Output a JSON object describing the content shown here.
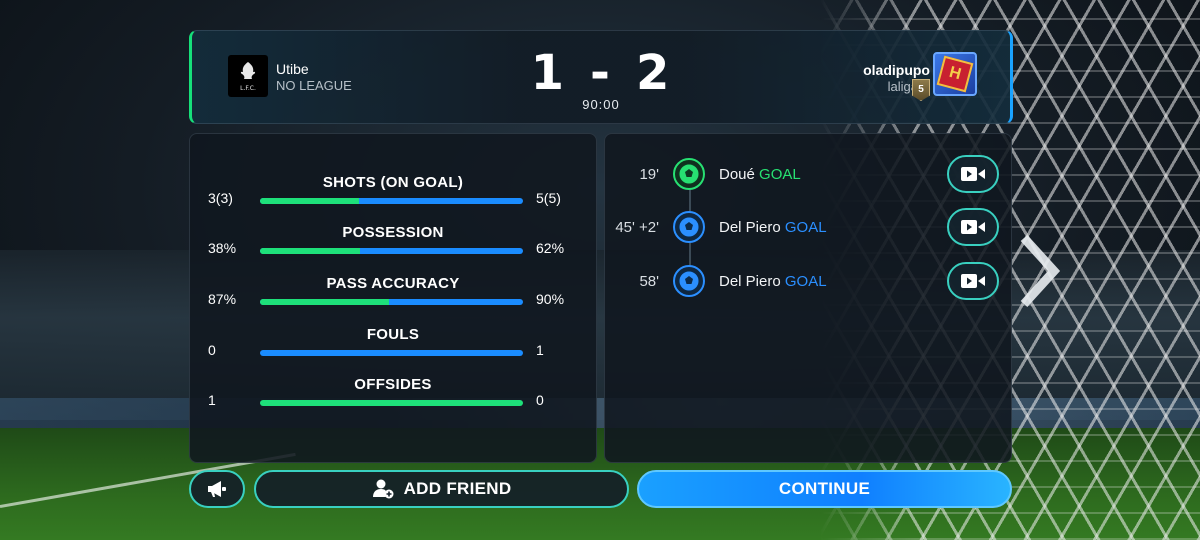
{
  "header": {
    "home": {
      "name": "Utibe",
      "league": "NO LEAGUE",
      "crest_icon": "liverpool-crest-icon",
      "crest_text": "L.F.C."
    },
    "away": {
      "name": "oladipupo",
      "league": "laliga",
      "rank_badge": "5",
      "crest_icon": "club-crest-icon",
      "crest_text": "H"
    },
    "score": {
      "home": "1",
      "separator": "-",
      "away": "2"
    },
    "time": "90:00"
  },
  "stats": [
    {
      "title": "SHOTS (ON GOAL)",
      "home": "3(3)",
      "away": "5(5)",
      "home_share": 0.375
    },
    {
      "title": "POSSESSION",
      "home": "38%",
      "away": "62%",
      "home_share": 0.38
    },
    {
      "title": "PASS ACCURACY",
      "home": "87%",
      "away": "90%",
      "home_share": 0.49
    },
    {
      "title": "FOULS",
      "home": "0",
      "away": "1",
      "home_share": 0.0
    },
    {
      "title": "OFFSIDES",
      "home": "1",
      "away": "0",
      "home_share": 1.0
    }
  ],
  "events": [
    {
      "minute": "19'",
      "player": "Doué",
      "type": "GOAL",
      "team": "home"
    },
    {
      "minute": "45' +2'",
      "player": "Del Piero",
      "type": "GOAL",
      "team": "away"
    },
    {
      "minute": "58'",
      "player": "Del Piero",
      "type": "GOAL",
      "team": "away"
    }
  ],
  "buttons": {
    "announce_icon": "megaphone-icon",
    "add_friend": "ADD FRIEND",
    "continue": "CONTINUE"
  },
  "colors": {
    "home_accent": "#1ee07a",
    "away_accent": "#1a8cff",
    "button_outline": "#39d0c0",
    "continue_bg": "#0f7fff"
  }
}
